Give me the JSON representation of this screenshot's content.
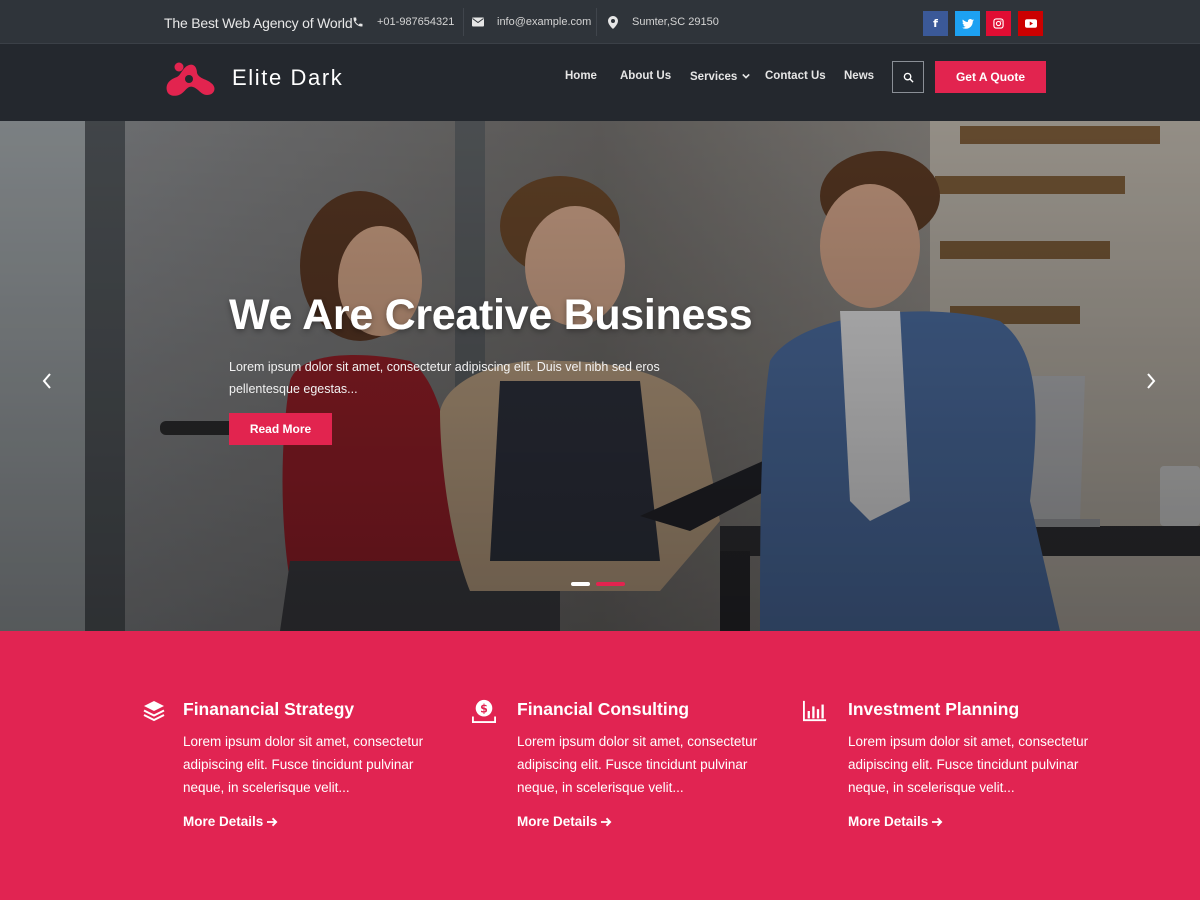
{
  "topbar": {
    "tagline": "The Best Web Agency of World",
    "phone": "+01-987654321",
    "email": "info@example.com",
    "address": "Sumter,SC 29150",
    "social": [
      {
        "name": "facebook",
        "icon": "f",
        "color": "#3b5998"
      },
      {
        "name": "twitter",
        "icon": "twitter-bird-icon",
        "color": "#1da1f2"
      },
      {
        "name": "instagram",
        "icon": "instagram-icon",
        "color": "#e1306c"
      },
      {
        "name": "youtube",
        "icon": "youtube-play-icon",
        "color": "#cc0000"
      }
    ]
  },
  "header": {
    "brand": "Elite Dark",
    "nav": [
      "Home",
      "About Us",
      "Services",
      "Contact Us",
      "News"
    ],
    "quote_button": "Get A Quote"
  },
  "hero": {
    "title": "We Are Creative Business",
    "text": "Lorem ipsum dolor sit amet, consectetur adipiscing elit. Duis vel nibh sed eros pellentesque egestas...",
    "button": "Read More",
    "slides_total": 2,
    "active_slide": 1
  },
  "features": [
    {
      "icon": "layers-icon",
      "title": "Finanancial Strategy",
      "text": "Lorem ipsum dolor sit amet, consectetur adipiscing elit. Fusce tincidunt pulvinar neque, in scelerisque velit...",
      "link": "More Details"
    },
    {
      "icon": "dollar-hand-icon",
      "title": "Financial Consulting",
      "text": "Lorem ipsum dolor sit amet, consectetur adipiscing elit. Fusce tincidunt pulvinar neque, in scelerisque velit...",
      "link": "More Details"
    },
    {
      "icon": "bar-chart-icon",
      "title": "Investment Planning",
      "text": "Lorem ipsum dolor sit amet, consectetur adipiscing elit. Fusce tincidunt pulvinar neque, in scelerisque velit...",
      "link": "More Details"
    }
  ],
  "colors": {
    "accent": "#e2244f",
    "topbar_bg": "#2f343a",
    "header_bg": "#24282e",
    "features_bg": "#e12452"
  }
}
